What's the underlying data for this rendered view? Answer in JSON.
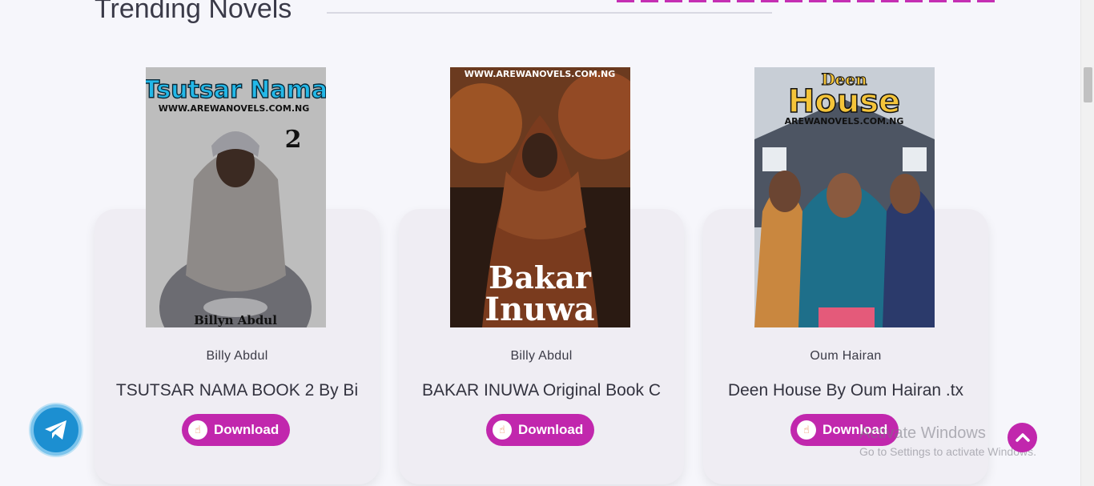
{
  "section": {
    "title": "Trending Novels"
  },
  "colors": {
    "accent": "#c127ad",
    "telegram": "#1c8fd1",
    "card_bg": "#efedf3",
    "page_bg": "#f6f6fb"
  },
  "novels": [
    {
      "author": "Billy Abdul",
      "title": "TSUTSAR NAMA BOOK 2 By Bi",
      "download_label": "Download",
      "cover_text": {
        "title": "Tsutsar Nama",
        "site": "WWW.AREWANOVELS.COM.NG",
        "number": "2",
        "author": "Billyn Abdul"
      }
    },
    {
      "author": "Billy Abdul",
      "title": "BAKAR INUWA Original Book C",
      "download_label": "Download",
      "cover_text": {
        "site": "WWW.AREWANOVELS.COM.NG",
        "line1": "Bakar",
        "line2": "Inuwa"
      }
    },
    {
      "author": "Oum Hairan",
      "title": "Deen House By Oum Hairan .tx",
      "download_label": "Download",
      "cover_text": {
        "line1": "Deen",
        "line2": "House",
        "site": "AREWANOVELS.COM.NG"
      }
    }
  ],
  "watermark": {
    "line1": "Activate Windows",
    "line2": "Go to Settings to activate Windows."
  },
  "icons": {
    "telegram": "telegram-icon",
    "scroll_top": "chevron-up-icon",
    "download": "pointer-hand-icon"
  }
}
